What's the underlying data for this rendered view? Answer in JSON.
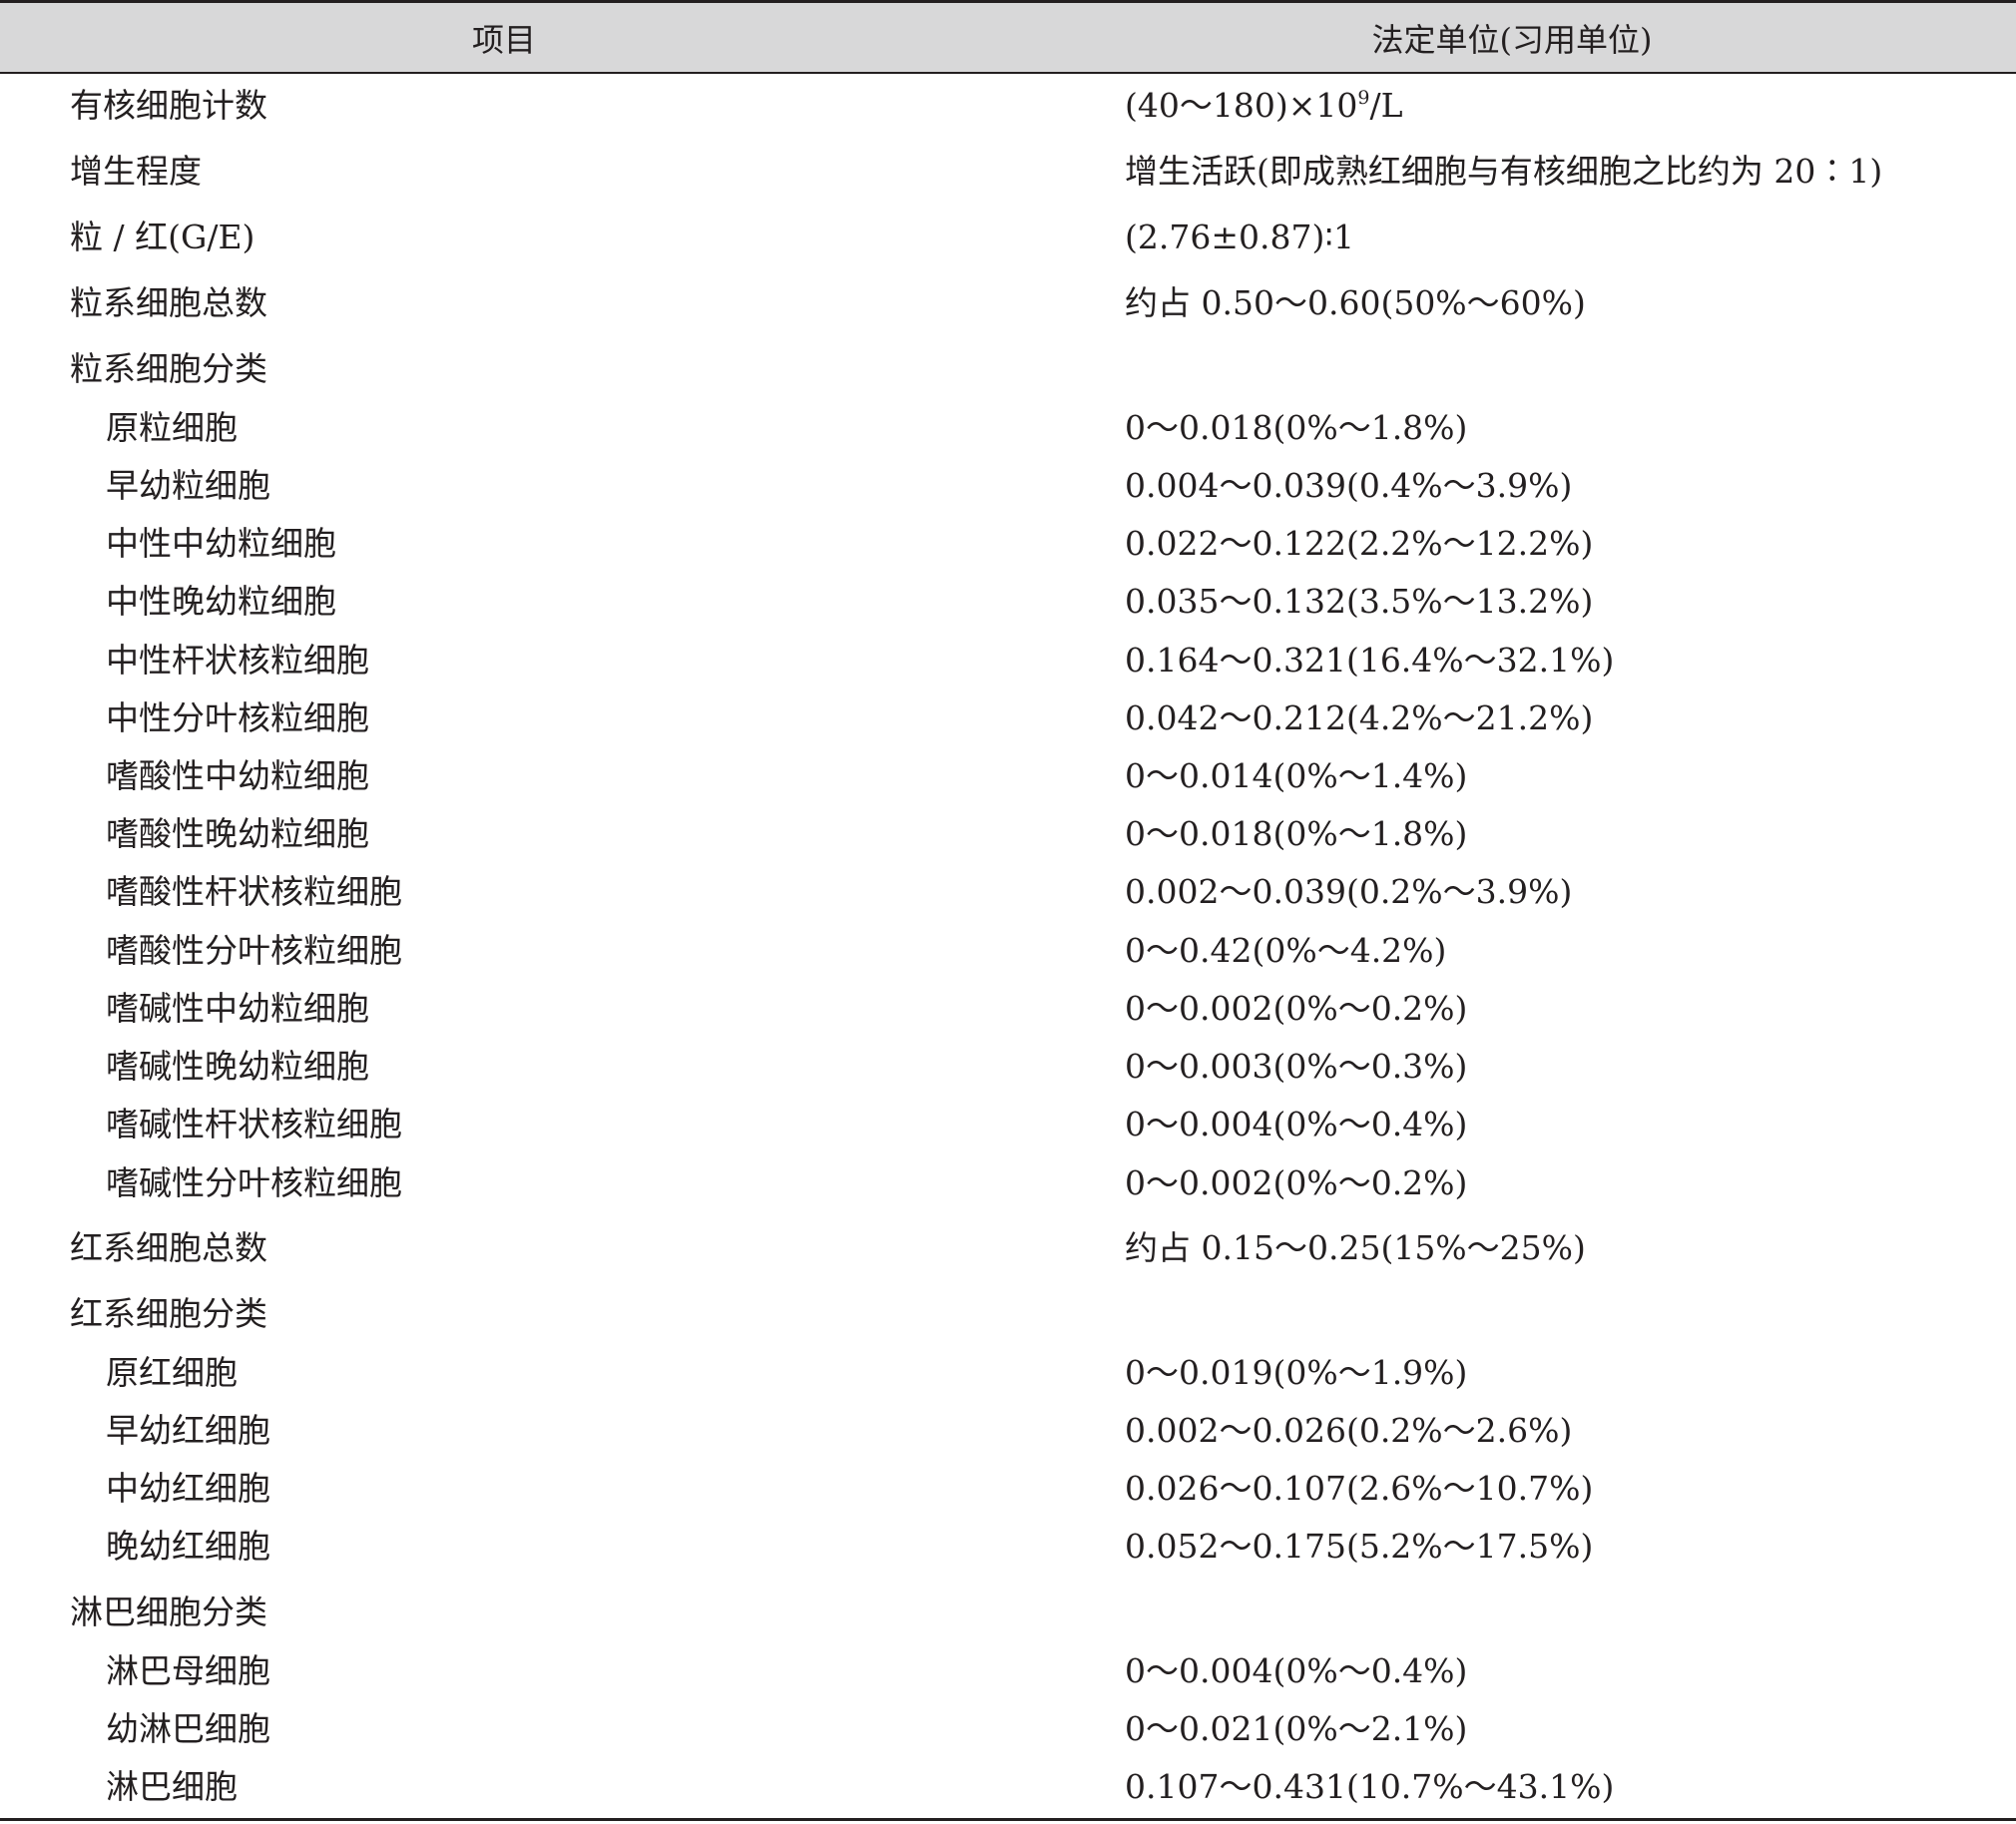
{
  "header": {
    "col_item": "项目",
    "col_value": "法定单位(习用单位)"
  },
  "rows": [
    {
      "item": "有核细胞计数",
      "value_pre": "(40～180)×10",
      "value_sup": "9",
      "value_post": "/L",
      "indent": 0
    },
    {
      "item": "增生程度",
      "value": "增生活跃(即成熟红细胞与有核细胞之比约为 20∶1)",
      "indent": 0
    },
    {
      "item": "粒 / 红(G/E)",
      "value": "(2.76±0.87)∶1",
      "indent": 0
    },
    {
      "item": "粒系细胞总数",
      "value": "约占 0.50～0.60(50%～60%)",
      "indent": 0
    },
    {
      "item": "粒系细胞分类",
      "value": "",
      "indent": 0
    },
    {
      "item": "原粒细胞",
      "value": "0～0.018(0%～1.8%)",
      "indent": 1
    },
    {
      "item": "早幼粒细胞",
      "value": "0.004～0.039(0.4%～3.9%)",
      "indent": 1
    },
    {
      "item": "中性中幼粒细胞",
      "value": "0.022～0.122(2.2%～12.2%)",
      "indent": 1
    },
    {
      "item": "中性晚幼粒细胞",
      "value": "0.035～0.132(3.5%～13.2%)",
      "indent": 1
    },
    {
      "item": "中性杆状核粒细胞",
      "value": "0.164～0.321(16.4%～32.1%)",
      "indent": 1
    },
    {
      "item": "中性分叶核粒细胞",
      "value": "0.042～0.212(4.2%～21.2%)",
      "indent": 1
    },
    {
      "item": "嗜酸性中幼粒细胞",
      "value": "0～0.014(0%～1.4%)",
      "indent": 1
    },
    {
      "item": "嗜酸性晚幼粒细胞",
      "value": "0～0.018(0%～1.8%)",
      "indent": 1
    },
    {
      "item": "嗜酸性杆状核粒细胞",
      "value": "0.002～0.039(0.2%～3.9%)",
      "indent": 1
    },
    {
      "item": "嗜酸性分叶核粒细胞",
      "value": "0～0.42(0%～4.2%)",
      "indent": 1
    },
    {
      "item": "嗜碱性中幼粒细胞",
      "value": "0～0.002(0%～0.2%)",
      "indent": 1
    },
    {
      "item": "嗜碱性晚幼粒细胞",
      "value": "0～0.003(0%～0.3%)",
      "indent": 1
    },
    {
      "item": "嗜碱性杆状核粒细胞",
      "value": "0～0.004(0%～0.4%)",
      "indent": 1
    },
    {
      "item": "嗜碱性分叶核粒细胞",
      "value": "0～0.002(0%～0.2%)",
      "indent": 1
    },
    {
      "item": "红系细胞总数",
      "value": "约占 0.15～0.25(15%～25%)",
      "indent": 0
    },
    {
      "item": "红系细胞分类",
      "value": "",
      "indent": 0
    },
    {
      "item": "原红细胞",
      "value": "0～0.019(0%～1.9%)",
      "indent": 1
    },
    {
      "item": "早幼红细胞",
      "value": "0.002～0.026(0.2%～2.6%)",
      "indent": 1
    },
    {
      "item": "中幼红细胞",
      "value": "0.026～0.107(2.6%～10.7%)",
      "indent": 1
    },
    {
      "item": "晚幼红细胞",
      "value": "0.052～0.175(5.2%～17.5%)",
      "indent": 1
    },
    {
      "item": "淋巴细胞分类",
      "value": "",
      "indent": 0
    },
    {
      "item": "淋巴母细胞",
      "value": "0～0.004(0%～0.4%)",
      "indent": 1
    },
    {
      "item": "幼淋巴细胞",
      "value": "0～0.021(0%～2.1%)",
      "indent": 1
    },
    {
      "item": "淋巴细胞",
      "value": "0.107～0.431(10.7%～43.1%)",
      "indent": 1
    }
  ]
}
